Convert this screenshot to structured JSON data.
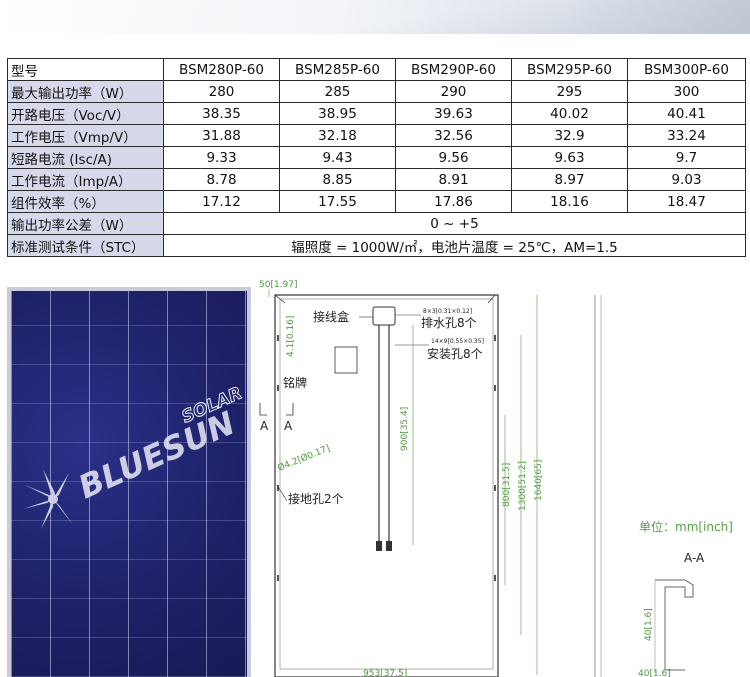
{
  "spec_table": {
    "header": [
      "型号",
      "BSM280P-60",
      "BSM285P-60",
      "BSM290P-60",
      "BSM295P-60",
      "BSM300P-60"
    ],
    "rows": [
      {
        "label": "最大输出功率（W）",
        "values": [
          "280",
          "285",
          "290",
          "295",
          "300"
        ]
      },
      {
        "label": "开路电压（Voc/V）",
        "values": [
          "38.35",
          "38.95",
          "39.63",
          "40.02",
          "40.41"
        ]
      },
      {
        "label": "工作电压（Vmp/V）",
        "values": [
          "31.88",
          "32.18",
          "32.56",
          "32.9",
          "33.24"
        ]
      },
      {
        "label": "短路电流 (Isc/A)",
        "values": [
          "9.33",
          "9.43",
          "9.56",
          "9.63",
          "9.7"
        ]
      },
      {
        "label": "工作电流（Imp/A）",
        "values": [
          "8.78",
          "8.85",
          "8.91",
          "8.97",
          "9.03"
        ]
      },
      {
        "label": "组件效率（%）",
        "values": [
          "17.12",
          "17.55",
          "17.86",
          "18.16",
          "18.47"
        ]
      }
    ],
    "tolerance": {
      "label": "输出功率公差（W）",
      "value": "0 ~ +5"
    },
    "stc": {
      "label": "标准测试条件（STC）",
      "value": "辐照度 = 1000W/㎡，电池片温度 = 25℃，AM=1.5"
    }
  },
  "logo": {
    "brand": "BLUESUN",
    "sub": "SOLAR"
  },
  "drawing": {
    "junction_box": "接线盒",
    "drain_holes": "排水孔8个",
    "drain_dim": "8×3[0.31×0.12]",
    "mount_holes": "安装孔8个",
    "mount_dim": "14×9[0.55×0.35]",
    "nameplate": "铭牌",
    "ground_holes": "接地孔2个",
    "ground_dim": "Ø4.2[Ø0.17]",
    "section_a": "A",
    "dims": {
      "top_offset": "50[1.97]",
      "box_offset": "4.1[0.16]",
      "cable": "900[35.4]",
      "h800": "800[31.5]",
      "h1300": "1300[51.2]",
      "h1640": "1640[65]",
      "width": "953[37.5]",
      "frame_h": "40[1.6]",
      "frame_w": "40[1.6]"
    },
    "section_title": "A-A",
    "unit_label": "单位：mm[inch]"
  }
}
